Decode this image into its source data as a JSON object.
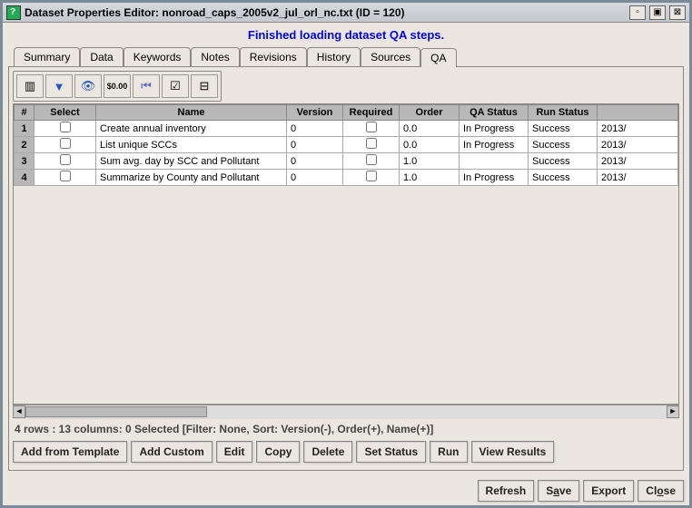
{
  "window": {
    "title": "Dataset Properties Editor: nonroad_caps_2005v2_jul_orl_nc.txt (ID = 120)"
  },
  "status_message": "Finished loading dataset QA steps.",
  "tabs": [
    "Summary",
    "Data",
    "Keywords",
    "Notes",
    "Revisions",
    "History",
    "Sources",
    "QA"
  ],
  "active_tab": "QA",
  "toolbar": {
    "icons": [
      "columns-icon",
      "filter-icon",
      "eye-icon",
      "money-format-icon",
      "first-icon",
      "checklist-icon",
      "split-icon"
    ]
  },
  "table": {
    "columns": [
      "#",
      "Select",
      "Name",
      "Version",
      "Required",
      "Order",
      "QA Status",
      "Run Status",
      ""
    ],
    "rows": [
      {
        "num": "1",
        "select": false,
        "name": "Create annual inventory",
        "version": "0",
        "required": false,
        "order": "0.0",
        "qa_status": "In Progress",
        "run_status": "Success",
        "extra": "2013/"
      },
      {
        "num": "2",
        "select": false,
        "name": "List unique SCCs",
        "version": "0",
        "required": false,
        "order": "0.0",
        "qa_status": "In Progress",
        "run_status": "Success",
        "extra": "2013/"
      },
      {
        "num": "3",
        "select": false,
        "name": "Sum avg. day by SCC and Pollutant",
        "version": "0",
        "required": false,
        "order": "1.0",
        "qa_status": "",
        "run_status": "Success",
        "extra": "2013/"
      },
      {
        "num": "4",
        "select": false,
        "name": "Summarize by County and Pollutant",
        "version": "0",
        "required": false,
        "order": "1.0",
        "qa_status": "In Progress",
        "run_status": "Success",
        "extra": "2013/"
      }
    ]
  },
  "stat_line": "4 rows : 13 columns: 0 Selected [Filter: None, Sort: Version(-), Order(+), Name(+)]",
  "actions": {
    "add_from_template": "Add from Template",
    "add_custom": "Add Custom",
    "edit": "Edit",
    "copy": "Copy",
    "delete": "Delete",
    "set_status": "Set Status",
    "run": "Run",
    "view_results": "View Results"
  },
  "bottom": {
    "refresh": "Refresh",
    "save_pre": "S",
    "save_u": "a",
    "save_post": "ve",
    "export": "Export",
    "close_pre": "Cl",
    "close_u": "o",
    "close_post": "se"
  }
}
